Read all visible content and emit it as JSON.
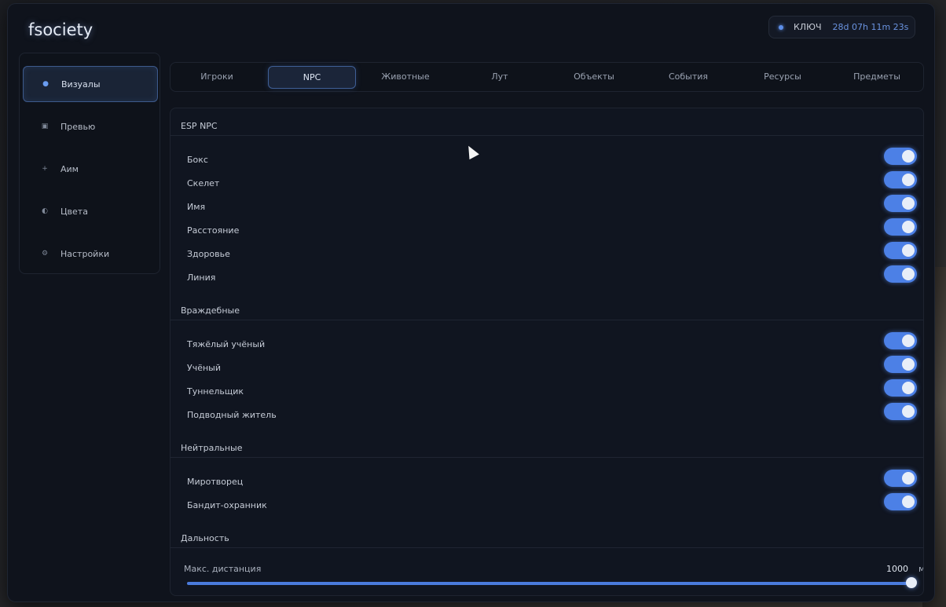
{
  "app": {
    "title": "fsociety"
  },
  "license": {
    "label": "КЛЮЧ",
    "time_left": "28d 07h 11m 23s",
    "accent": "#5d8ee8"
  },
  "sidebar": {
    "items": [
      {
        "label": "Визуалы",
        "icon": "dot-icon",
        "active": true
      },
      {
        "label": "Превью",
        "icon": "square-icon",
        "active": false
      },
      {
        "label": "Аим",
        "icon": "plus-icon",
        "active": false
      },
      {
        "label": "Цвета",
        "icon": "half-circle-icon",
        "active": false
      },
      {
        "label": "Настройки",
        "icon": "gear-icon",
        "active": false
      }
    ]
  },
  "tabs": [
    {
      "label": "Игроки",
      "active": false
    },
    {
      "label": "NPC",
      "active": true
    },
    {
      "label": "Животные",
      "active": false
    },
    {
      "label": "Лут",
      "active": false
    },
    {
      "label": "Объекты",
      "active": false
    },
    {
      "label": "События",
      "active": false
    },
    {
      "label": "Ресурсы",
      "active": false
    },
    {
      "label": "Предметы",
      "active": false
    }
  ],
  "sections": [
    {
      "title": "ESP NPC",
      "rows": [
        {
          "label": "Бокс",
          "enabled": true
        },
        {
          "label": "Скелет",
          "enabled": true
        },
        {
          "label": "Имя",
          "enabled": true
        },
        {
          "label": "Расстояние",
          "enabled": true
        },
        {
          "label": "Здоровье",
          "enabled": true
        },
        {
          "label": "Линия",
          "enabled": true
        }
      ]
    },
    {
      "title": "Враждебные",
      "rows": [
        {
          "label": "Тяжёлый учёный",
          "enabled": true
        },
        {
          "label": "Учёный",
          "enabled": true
        },
        {
          "label": "Туннельщик",
          "enabled": true
        },
        {
          "label": "Подводный житель",
          "enabled": true
        }
      ]
    },
    {
      "title": "Нейтральные",
      "rows": [
        {
          "label": "Миротворец",
          "enabled": true
        },
        {
          "label": "Бандит-охранник",
          "enabled": true
        }
      ]
    },
    {
      "title": "Дальность",
      "rows": []
    }
  ],
  "distance": {
    "label": "Макс. дистанция",
    "value": "1000",
    "unit": "м",
    "fraction": 1.0
  },
  "colors": {
    "toggle_on": "#4c80e6",
    "background": "#0f131c"
  }
}
